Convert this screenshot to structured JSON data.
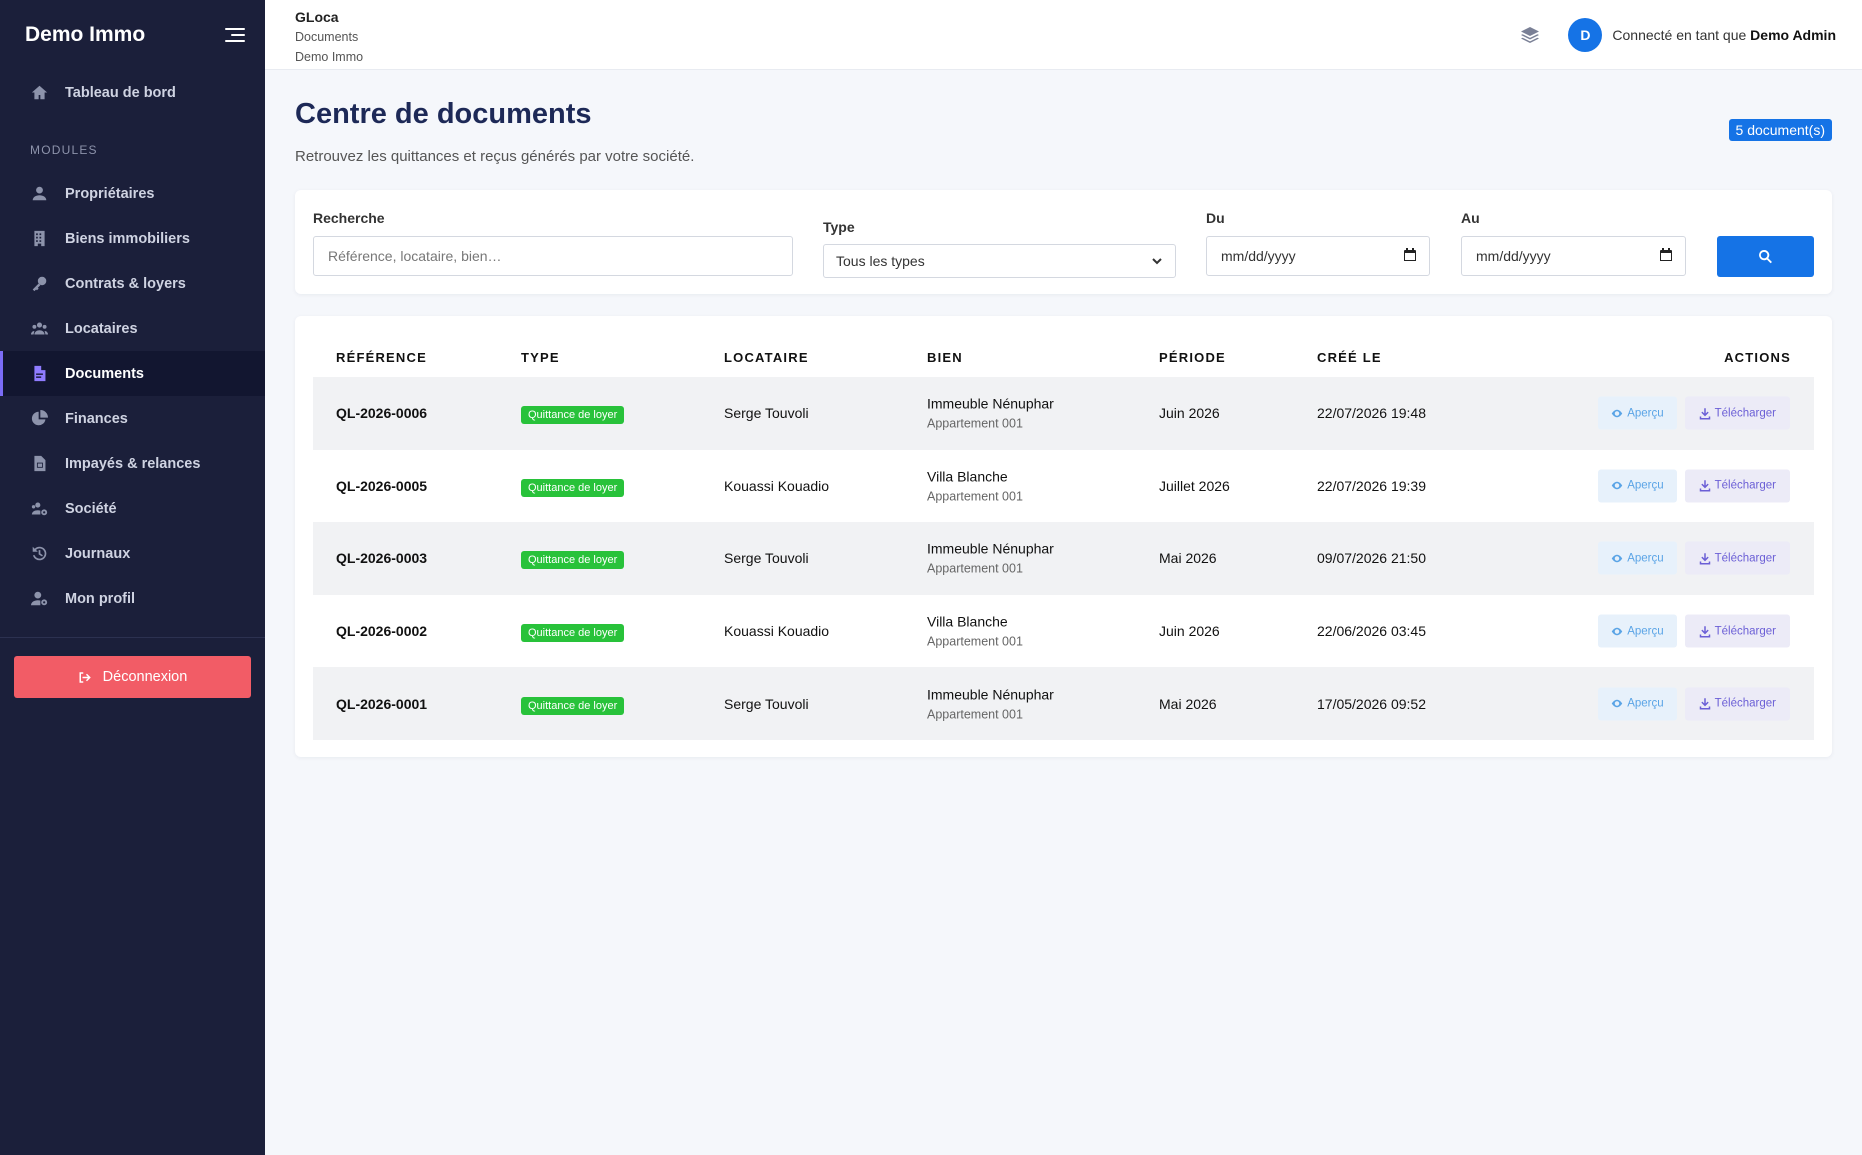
{
  "sidebar": {
    "brand": "Demo Immo",
    "dashboard": "Tableau de bord",
    "section": "MODULES",
    "items": [
      {
        "label": "Propriétaires",
        "icon": "user-icon"
      },
      {
        "label": "Biens immobiliers",
        "icon": "building-icon"
      },
      {
        "label": "Contrats & loyers",
        "icon": "key-icon"
      },
      {
        "label": "Locataires",
        "icon": "users-icon"
      },
      {
        "label": "Documents",
        "icon": "file-pdf-icon"
      },
      {
        "label": "Finances",
        "icon": "pie-chart-icon"
      },
      {
        "label": "Impayés & relances",
        "icon": "file-invoice-icon"
      },
      {
        "label": "Société",
        "icon": "users-cog-icon"
      },
      {
        "label": "Journaux",
        "icon": "history-icon"
      },
      {
        "label": "Mon profil",
        "icon": "user-cog-icon"
      }
    ],
    "logout": "Déconnexion"
  },
  "topbar": {
    "app": "GLoca",
    "crumb1": "Documents",
    "crumb2": "Demo Immo",
    "avatar": "D",
    "connected_as": "Connecté en tant que",
    "user": "Demo Admin"
  },
  "page": {
    "title": "Centre de documents",
    "subtitle": "Retrouvez les quittances et reçus générés par votre société.",
    "count": "5 document(s)"
  },
  "filters": {
    "search_label": "Recherche",
    "search_placeholder": "Référence, locataire, bien…",
    "type_label": "Type",
    "type_value": "Tous les types",
    "from_label": "Du",
    "from_value": "mm/dd/yyyy",
    "to_label": "Au",
    "to_value": "mm/dd/yyyy"
  },
  "table": {
    "headers": [
      "RÉFÉRENCE",
      "TYPE",
      "LOCATAIRE",
      "BIEN",
      "PÉRIODE",
      "CRÉÉ LE",
      "ACTIONS"
    ],
    "preview_label": "Aperçu",
    "download_label": "Télécharger",
    "rows": [
      {
        "ref": "QL-2026-0006",
        "type": "Quittance de loyer",
        "tenant": "Serge Touvoli",
        "property": "Immeuble Nénuphar",
        "unit": "Appartement 001",
        "period": "Juin 2026",
        "created": "22/07/2026 19:48"
      },
      {
        "ref": "QL-2026-0005",
        "type": "Quittance de loyer",
        "tenant": "Kouassi Kouadio",
        "property": "Villa Blanche",
        "unit": "Appartement 001",
        "period": "Juillet 2026",
        "created": "22/07/2026 19:39"
      },
      {
        "ref": "QL-2026-0003",
        "type": "Quittance de loyer",
        "tenant": "Serge Touvoli",
        "property": "Immeuble Nénuphar",
        "unit": "Appartement 001",
        "period": "Mai 2026",
        "created": "09/07/2026 21:50"
      },
      {
        "ref": "QL-2026-0002",
        "type": "Quittance de loyer",
        "tenant": "Kouassi Kouadio",
        "property": "Villa Blanche",
        "unit": "Appartement 001",
        "period": "Juin 2026",
        "created": "22/06/2026 03:45"
      },
      {
        "ref": "QL-2026-0001",
        "type": "Quittance de loyer",
        "tenant": "Serge Touvoli",
        "property": "Immeuble Nénuphar",
        "unit": "Appartement 001",
        "period": "Mai 2026",
        "created": "17/05/2026 09:52"
      }
    ]
  }
}
